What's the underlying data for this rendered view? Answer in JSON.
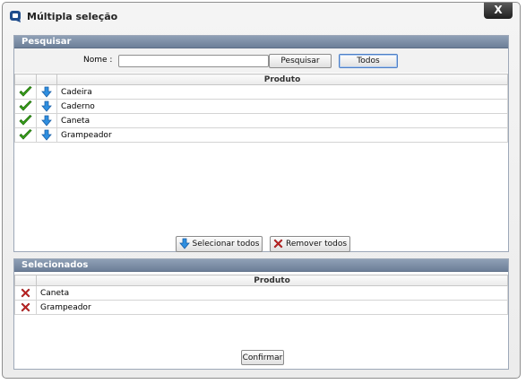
{
  "window": {
    "title": "Múltipla seleção",
    "close_label": "X"
  },
  "search": {
    "header": "Pesquisar",
    "name_label": "Nome :",
    "name_value": "",
    "search_button": "Pesquisar",
    "all_button": "Todos",
    "column_header": "Produto",
    "items": [
      {
        "name": "Cadeira",
        "icons": [
          "check-icon",
          "arrow-down-icon"
        ]
      },
      {
        "name": "Caderno",
        "icons": [
          "check-icon",
          "arrow-down-icon"
        ]
      },
      {
        "name": "Caneta",
        "icons": [
          "check-icon",
          "arrow-down-icon"
        ]
      },
      {
        "name": "Grampeador",
        "icons": [
          "check-icon",
          "arrow-down-icon"
        ]
      }
    ]
  },
  "actions": {
    "select_all": "Selecionar todos",
    "remove_all": "Remover todos"
  },
  "selected": {
    "header": "Selecionados",
    "column_header": "Produto",
    "items": [
      {
        "name": "Caneta",
        "icon": "remove-x-icon"
      },
      {
        "name": "Grampeador",
        "icon": "remove-x-icon"
      }
    ]
  },
  "footer": {
    "confirm": "Confirmar"
  },
  "colors": {
    "panel_header": "#7d8ea6",
    "accent_check": "#3aa31c",
    "accent_arrow": "#2f8fe0",
    "remove_red": "#d42a2a"
  }
}
